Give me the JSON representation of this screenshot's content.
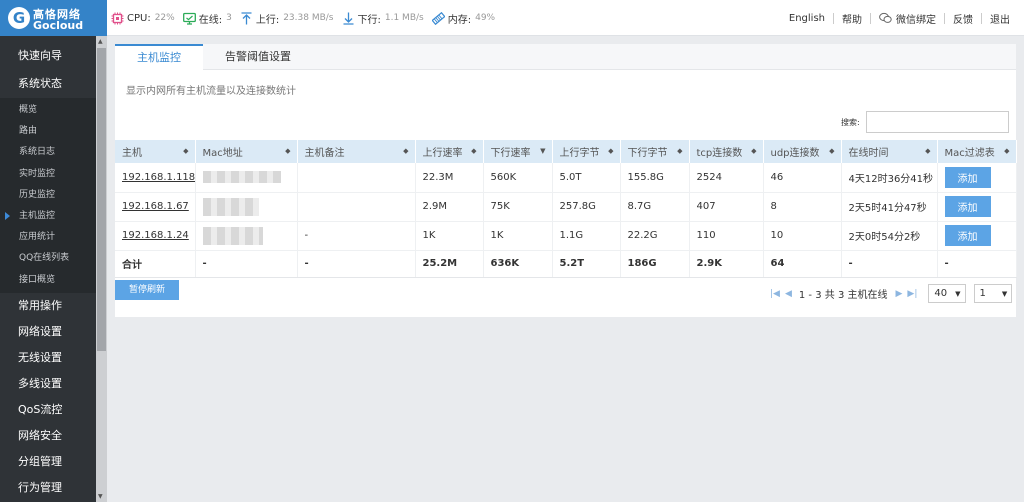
{
  "logo": {
    "cn": "高恪网络",
    "en": "Gocloud"
  },
  "stats": {
    "cpu_label": "CPU:",
    "cpu_value": "22%",
    "online_label": "在线:",
    "online_value": "3",
    "up_label": "上行:",
    "up_value": "23.38 MB/s",
    "down_label": "下行:",
    "down_value": "1.1 MB/s",
    "mem_label": "内存:",
    "mem_value": "49%"
  },
  "toplinks": {
    "english": "English",
    "help": "帮助",
    "wechat": "微信绑定",
    "feedback": "反馈",
    "logout": "退出"
  },
  "sidebar": {
    "top_items": [
      {
        "label": "快速向导"
      },
      {
        "label": "系统状态"
      }
    ],
    "sub_items": [
      {
        "label": "概览"
      },
      {
        "label": "路由"
      },
      {
        "label": "系统日志"
      },
      {
        "label": "实时监控"
      },
      {
        "label": "历史监控"
      },
      {
        "label": "主机监控",
        "active": true
      },
      {
        "label": "应用统计"
      },
      {
        "label": "QQ在线列表"
      },
      {
        "label": "接口概览"
      }
    ],
    "bottom_items": [
      {
        "label": "常用操作"
      },
      {
        "label": "网络设置"
      },
      {
        "label": "无线设置"
      },
      {
        "label": "多线设置"
      },
      {
        "label": "QoS流控"
      },
      {
        "label": "网络安全"
      },
      {
        "label": "分组管理"
      },
      {
        "label": "行为管理"
      }
    ]
  },
  "tabs": [
    {
      "label": "主机监控",
      "active": true
    },
    {
      "label": "告警阈值设置"
    }
  ],
  "description": "显示内网所有主机流量以及连接数统计",
  "search": {
    "label": "搜索:",
    "value": ""
  },
  "table": {
    "headers": [
      "主机",
      "Mac地址",
      "主机备注",
      "上行速率",
      "下行速率",
      "上行字节",
      "下行字节",
      "tcp连接数",
      "udp连接数",
      "在线时间",
      "Mac过滤表"
    ],
    "rows": [
      {
        "host": "192.168.1.118",
        "remark": "",
        "up_rate": "22.3M",
        "down_rate": "560K",
        "up_bytes": "5.0T",
        "down_bytes": "155.8G",
        "tcp": "2524",
        "udp": "46",
        "online": "4天12时36分41秒",
        "action": "添加"
      },
      {
        "host": "192.168.1.67",
        "remark": "",
        "up_rate": "2.9M",
        "down_rate": "75K",
        "up_bytes": "257.8G",
        "down_bytes": "8.7G",
        "tcp": "407",
        "udp": "8",
        "online": "2天5时41分47秒",
        "action": "添加"
      },
      {
        "host": "192.168.1.24",
        "remark": "-",
        "up_rate": "1K",
        "down_rate": "1K",
        "up_bytes": "1.1G",
        "down_bytes": "22.2G",
        "tcp": "110",
        "udp": "10",
        "online": "2天0时54分2秒",
        "action": "添加"
      }
    ],
    "total": {
      "host": "合计",
      "mac": "-",
      "remark": "-",
      "up_rate": "25.2M",
      "down_rate": "636K",
      "up_bytes": "5.2T",
      "down_bytes": "186G",
      "tcp": "2.9K",
      "udp": "64",
      "online": "-",
      "action": "-"
    }
  },
  "pause_label": "暂停刷新",
  "pager": {
    "info": "1 - 3 共 3 主机在线",
    "page_size": "40",
    "page": "1"
  },
  "colors": {
    "accent": "#3a8ad2",
    "sidebar_bg": "#2f3337",
    "logo_bg": "#3483c8",
    "button": "#5ca4e5",
    "header_bg": "#dbeaf6"
  }
}
